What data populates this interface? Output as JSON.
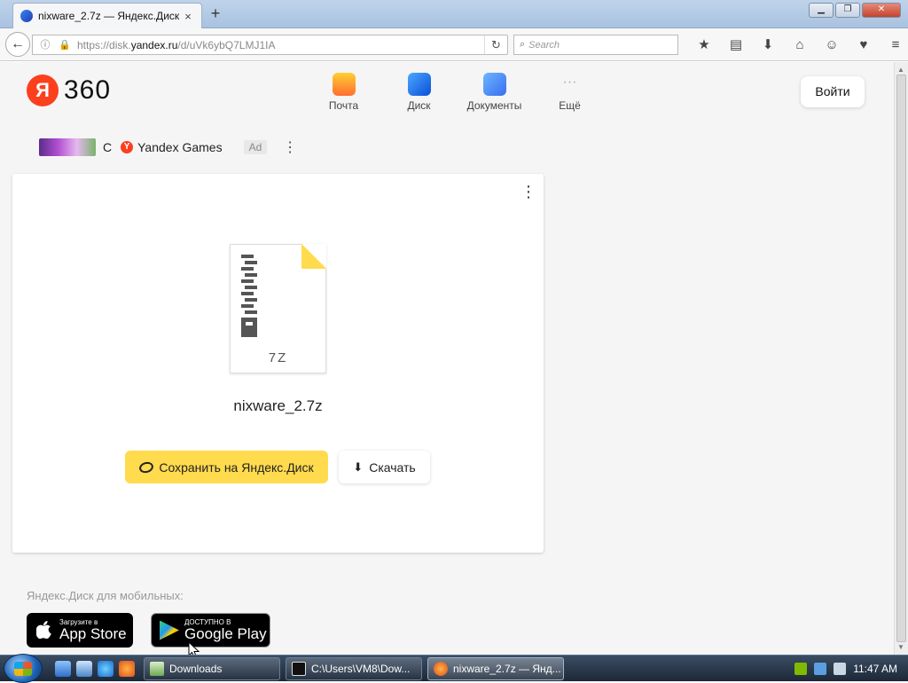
{
  "browser": {
    "tab_title": "nixware_2.7z — Яндекс.Диск",
    "tab_close": "×",
    "new_tab": "+",
    "window_buttons": {
      "minimize": "▁",
      "restore": "❐",
      "close": "✕"
    },
    "back": "←",
    "url_prefix": "https://disk.",
    "url_host": "yandex.ru",
    "url_path": "/d/uVk6ybQ7LMJ1IA",
    "reload": "↻",
    "search_placeholder": "Search",
    "toolbar_icons": [
      "★",
      "▤",
      "⬇",
      "⌂",
      "☺",
      "♥",
      "≡"
    ]
  },
  "header": {
    "logo_letter": "Я",
    "logo_number": "360",
    "services": [
      {
        "label": "Почта"
      },
      {
        "label": "Диск"
      },
      {
        "label": "Документы"
      },
      {
        "label": "Ещё"
      }
    ],
    "more_glyph": "···",
    "login_label": "Войти"
  },
  "ad": {
    "c_letter": "C",
    "brand_letter": "Y",
    "brand": "Yandex Games",
    "ad_badge": "Ad",
    "menu": "⋮"
  },
  "file_card": {
    "menu": "⋮",
    "extension": "7Z",
    "file_name": "nixware_2.7z",
    "save_button": "Сохранить на Яндекс.Диск",
    "download_button": "Скачать",
    "download_glyph": "⬇"
  },
  "mobile": {
    "caption": "Яндекс.Диск для мобильных:",
    "app_store_small": "Загрузите в",
    "app_store_big": "App Store",
    "app_store_glyph": "",
    "google_play_small": "ДОСТУПНО В",
    "google_play_big": "Google Play"
  },
  "taskbar": {
    "items": [
      {
        "label": "Downloads"
      },
      {
        "label": "C:\\Users\\VM8\\Dow..."
      },
      {
        "label": "nixware_2.7z — Янд..."
      }
    ],
    "clock": "11:47 AM"
  },
  "colors": {
    "accent_yellow": "#ffdb4d",
    "yandex_red": "#fc3f1d",
    "page_bg": "#f5f5f5"
  }
}
